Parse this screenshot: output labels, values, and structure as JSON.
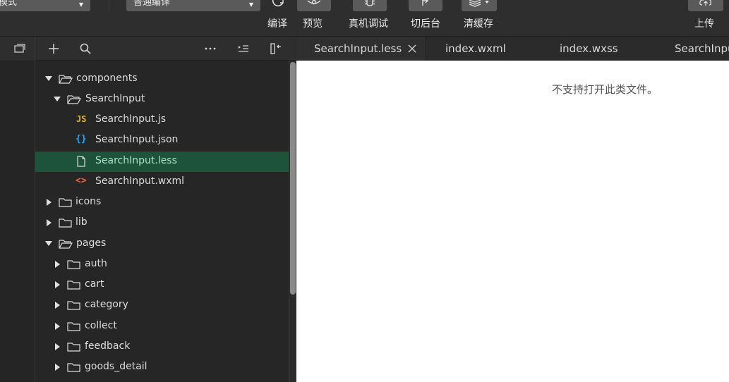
{
  "toolbar": {
    "mode_label": "模式",
    "compile_select": "普通编译",
    "buttons": {
      "compile": "编译",
      "preview": "预览",
      "remote_debug": "真机调试",
      "background": "切后台",
      "clear_cache": "清缓存",
      "upload": "上传"
    }
  },
  "explorer": {
    "tree": [
      {
        "label": "components",
        "kind": "folder",
        "expanded": true
      },
      {
        "label": "SearchInput",
        "kind": "folder",
        "expanded": true
      },
      {
        "label": "SearchInput.js",
        "kind": "file",
        "icon": "js-file-icon"
      },
      {
        "label": "SearchInput.json",
        "kind": "file",
        "icon": "json-file-icon"
      },
      {
        "label": "SearchInput.less",
        "kind": "file",
        "icon": "file-icon",
        "selected": true
      },
      {
        "label": "SearchInput.wxml",
        "kind": "file",
        "icon": "wxml-file-icon"
      },
      {
        "label": "icons",
        "kind": "folder",
        "expanded": false
      },
      {
        "label": "lib",
        "kind": "folder",
        "expanded": false
      },
      {
        "label": "pages",
        "kind": "folder",
        "expanded": true
      },
      {
        "label": "auth",
        "kind": "folder",
        "expanded": false
      },
      {
        "label": "cart",
        "kind": "folder",
        "expanded": false
      },
      {
        "label": "category",
        "kind": "folder",
        "expanded": false
      },
      {
        "label": "collect",
        "kind": "folder",
        "expanded": false
      },
      {
        "label": "feedback",
        "kind": "folder",
        "expanded": false
      },
      {
        "label": "goods_detail",
        "kind": "folder",
        "expanded": false
      }
    ]
  },
  "tabs": [
    {
      "label": "SearchInput.less",
      "active": true
    },
    {
      "label": "index.wxml",
      "active": false
    },
    {
      "label": "index.wxss",
      "active": false
    },
    {
      "label": "SearchInput",
      "active": false
    }
  ],
  "editor": {
    "message": "不支持打开此类文件。"
  },
  "colors": {
    "selected_row": "#1d533a",
    "selected_text": "#a9e5c2",
    "js_icon": "#e5b62c",
    "json_icon": "#35a2e8",
    "wxml_icon": "#e8643a"
  }
}
